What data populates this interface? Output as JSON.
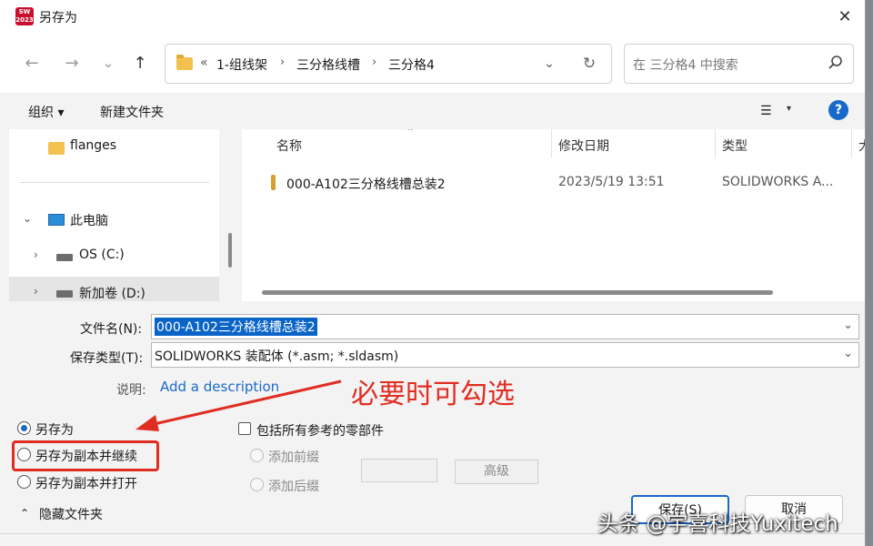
{
  "window": {
    "app_icon_text": "SW\n2023",
    "title": "另存为",
    "close_glyph": "✕"
  },
  "nav": {
    "back_glyph": "←",
    "forward_glyph": "→",
    "recent_glyph": "⌄",
    "up_glyph": "↑",
    "breadcrumb_prefix": "«",
    "breadcrumb": [
      "1-组线架",
      "三分格线槽",
      "三分格4"
    ],
    "breadcrumb_sep": "›",
    "dropdown_glyph": "⌄",
    "refresh_glyph": "↻",
    "search_placeholder": "在 三分格4 中搜索"
  },
  "toolbar": {
    "organize_label": "组织 ▾",
    "new_folder_label": "新建文件夹",
    "view_glyph": "☰",
    "view_dropdown_glyph": "▾",
    "help_glyph": "?"
  },
  "nav_pane": {
    "items": [
      {
        "label": "flanges",
        "icon": "folder-icon",
        "selected": false
      },
      {
        "label": "此电脑",
        "icon": "computer-icon",
        "expand": "⌄",
        "selected": false
      },
      {
        "label": "OS (C:)",
        "icon": "drive-icon",
        "expand": "›",
        "selected": false
      },
      {
        "label": "新加卷 (D:)",
        "icon": "drive-icon",
        "expand": "›",
        "selected": true
      }
    ]
  },
  "file_list": {
    "sort_glyph": "⌃",
    "columns": [
      "名称",
      "修改日期",
      "类型",
      "大"
    ],
    "rows": [
      {
        "name": "000-A102三分格线槽总装2",
        "date": "2023/5/19 13:51",
        "type": "SOLIDWORKS A..."
      }
    ]
  },
  "form": {
    "filename_label": "文件名(N):",
    "filename_value": "000-A102三分格线槽总装2",
    "filetype_label": "保存类型(T):",
    "filetype_value": "SOLIDWORKS 装配体 (*.asm; *.sldasm)",
    "description_label": "说明:",
    "description_link": "Add a description",
    "dropdown_glyph": "⌄"
  },
  "options": {
    "radios": [
      {
        "label": "另存为",
        "checked": true
      },
      {
        "label": "另存为副本并继续",
        "checked": false
      },
      {
        "label": "另存为副本并打开",
        "checked": false
      }
    ],
    "include_refs_label": "包括所有参考的零部件",
    "add_prefix_label": "添加前缀",
    "add_suffix_label": "添加后缀",
    "advanced_label": "高级"
  },
  "footer": {
    "hide_folders_label": "隐藏文件夹",
    "hide_glyph": "⌃",
    "save_label": "保存(S)",
    "cancel_label": "取消"
  },
  "annotation": {
    "text": "必要时可勾选",
    "color": "#e02d22"
  },
  "watermark": "头条 @宇喜科技Yuxitech"
}
